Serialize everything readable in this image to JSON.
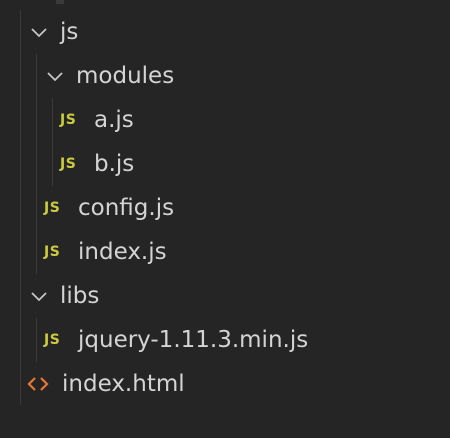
{
  "explorer": {
    "items": [
      {
        "label": "js",
        "kind": "folder",
        "expanded": true,
        "icon": "chevron-down-icon"
      },
      {
        "label": "modules",
        "kind": "folder",
        "expanded": true,
        "icon": "chevron-down-icon"
      },
      {
        "label": "a.js",
        "kind": "file",
        "icon_text": "JS"
      },
      {
        "label": "b.js",
        "kind": "file",
        "icon_text": "JS"
      },
      {
        "label": "config.js",
        "kind": "file",
        "icon_text": "JS"
      },
      {
        "label": "index.js",
        "kind": "file",
        "icon_text": "JS"
      },
      {
        "label": "libs",
        "kind": "folder",
        "expanded": true,
        "icon": "chevron-down-icon"
      },
      {
        "label": "jquery-1.11.3.min.js",
        "kind": "file",
        "icon_text": "JS"
      },
      {
        "label": "index.html",
        "kind": "file",
        "icon": "html-brackets-icon"
      }
    ]
  },
  "colors": {
    "background": "#252526",
    "text": "#d4d4d4",
    "js_icon": "#cbcb41",
    "html_icon": "#e37933",
    "indent_guide": "#3a3a3a"
  }
}
